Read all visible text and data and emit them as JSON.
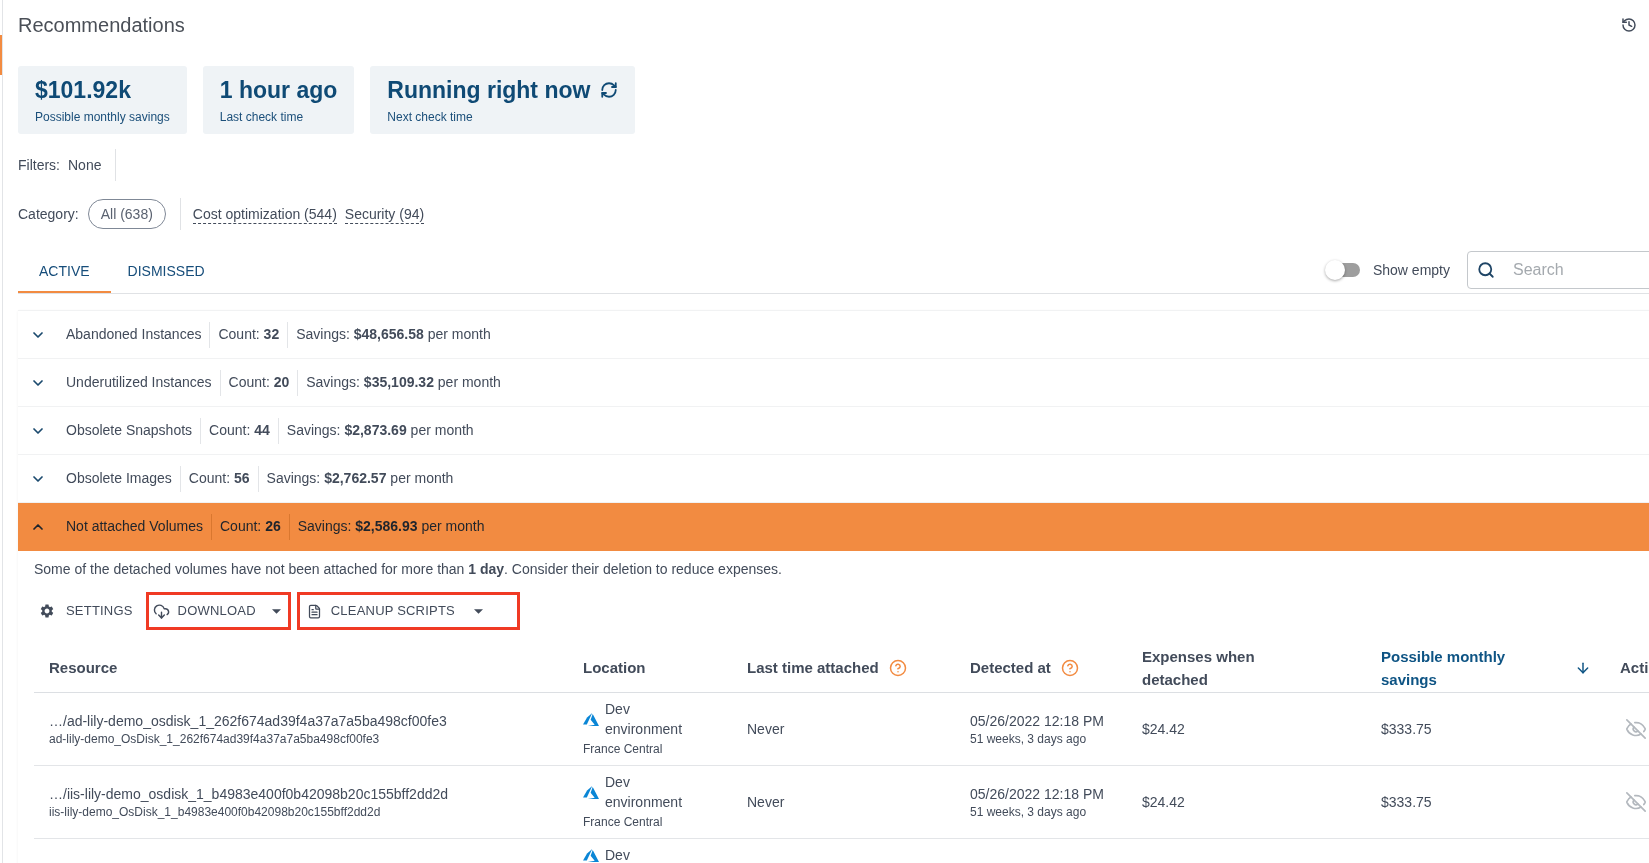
{
  "page": {
    "title": "Recommendations"
  },
  "stats": [
    {
      "value": "$101.92k",
      "label": "Possible monthly savings",
      "running": false
    },
    {
      "value": "1 hour ago",
      "label": "Last check time",
      "running": false
    },
    {
      "value": "Running right now",
      "label": "Next check time",
      "running": true
    }
  ],
  "filters": {
    "label": "Filters:",
    "value": "None"
  },
  "category": {
    "label": "Category:",
    "options": [
      {
        "label": "All (638)",
        "selected": true
      },
      {
        "label": "Cost optimization (544)",
        "selected": false
      },
      {
        "label": "Security (94)",
        "selected": false
      }
    ]
  },
  "tabs": [
    {
      "label": "ACTIVE",
      "selected": true
    },
    {
      "label": "DISMISSED",
      "selected": false
    }
  ],
  "show_empty": {
    "label": "Show empty",
    "on": false
  },
  "search": {
    "placeholder": "Search"
  },
  "groups": [
    {
      "title": "Abandoned Instances",
      "count": "Count: **32**",
      "savings": "Savings: **$48,656.58** per month",
      "expanded": false
    },
    {
      "title": "Underutilized Instances",
      "count": "Count: **20**",
      "savings": "Savings: **$35,109.32** per month",
      "expanded": false
    },
    {
      "title": "Obsolete Snapshots",
      "count": "Count: **44**",
      "savings": "Savings: **$2,873.69** per month",
      "expanded": false
    },
    {
      "title": "Obsolete Images",
      "count": "Count: **56**",
      "savings": "Savings: **$2,762.57** per month",
      "expanded": false
    },
    {
      "title": "Not attached Volumes",
      "count": "Count: **26**",
      "savings": "Savings: **$2,586.93** per month",
      "expanded": true
    }
  ],
  "details": {
    "description": "Some of the detached volumes have not been attached for more than **1 day**. Consider their deletion to reduce expenses.",
    "actions": [
      {
        "kind": "settings",
        "label": "SETTINGS",
        "dropdown": false,
        "highlighted": false
      },
      {
        "kind": "download",
        "label": "DOWNLOAD",
        "dropdown": true,
        "highlighted": true
      },
      {
        "kind": "scripts",
        "label": "CLEANUP SCRIPTS",
        "dropdown": true,
        "highlighted": true
      }
    ],
    "table": {
      "columns": [
        {
          "label": "Resource",
          "help": false,
          "sorted": false
        },
        {
          "label": "Location",
          "help": false,
          "sorted": false
        },
        {
          "label": "Last time attached",
          "help": true,
          "sorted": false
        },
        {
          "label": "Detected at",
          "help": true,
          "sorted": false
        },
        {
          "label": "Expenses when detached",
          "help": false,
          "sorted": false
        },
        {
          "label": "Possible monthly savings",
          "help": false,
          "sorted": true
        },
        {
          "label": "Acti",
          "help": false,
          "sorted": false
        }
      ],
      "rows": [
        {
          "resource": "…/ad-lily-demo_osdisk_1_262f674ad39f4a37a7a5ba498cf00fe3",
          "resource_name": "ad-lily-demo_OsDisk_1_262f674ad39f4a37a7a5ba498cf00fe3",
          "location": "Dev environment",
          "region": "France Central",
          "last_attached": "Never",
          "detected": "05/26/2022 12:18 PM",
          "detected_ago": "51 weeks, 3 days ago",
          "expenses": "$24.42",
          "savings": "$333.75"
        },
        {
          "resource": "…/iis-lily-demo_osdisk_1_b4983e400f0b42098b20c155bff2dd2d",
          "resource_name": "iis-lily-demo_OsDisk_1_b4983e400f0b42098b20c155bff2dd2d",
          "location": "Dev environment",
          "region": "France Central",
          "last_attached": "Never",
          "detected": "05/26/2022 12:18 PM",
          "detected_ago": "51 weeks, 3 days ago",
          "expenses": "$24.42",
          "savings": "$333.75"
        },
        {
          "location": "Dev"
        }
      ]
    }
  }
}
